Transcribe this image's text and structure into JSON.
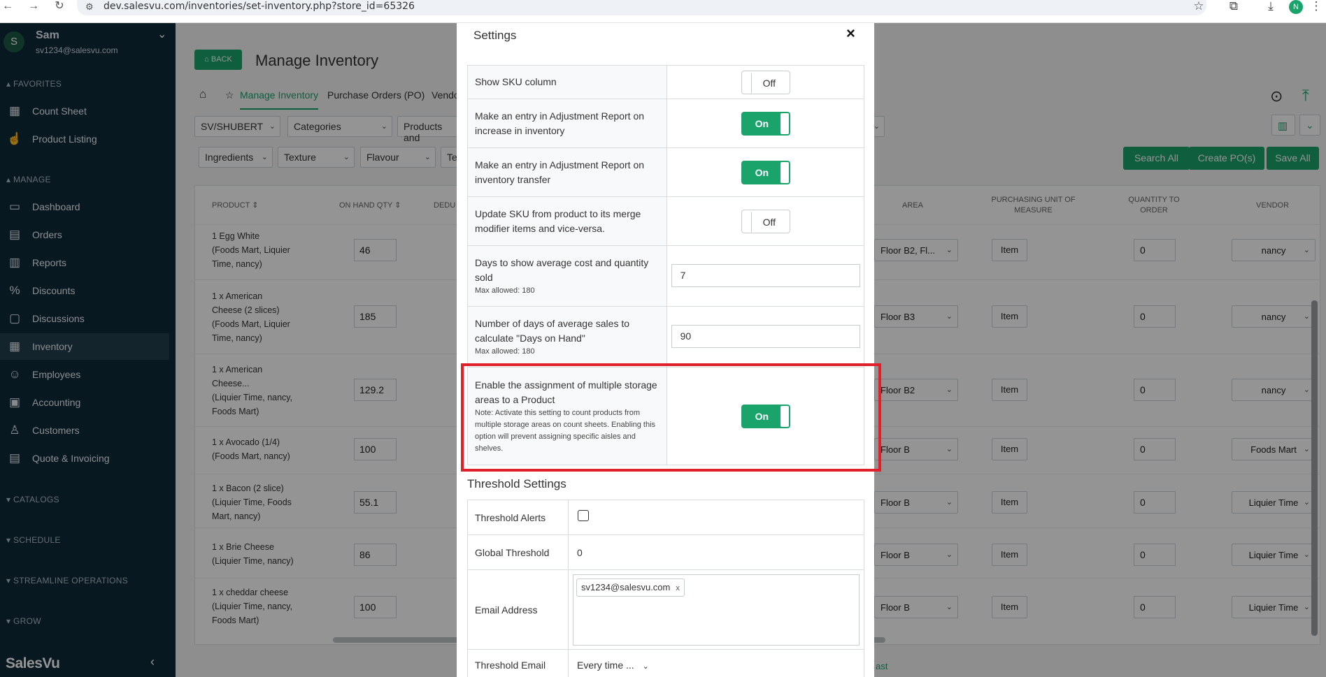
{
  "browser": {
    "url": "dev.salesvu.com/inventories/set-inventory.php?store_id=65326",
    "profile_initial": "N"
  },
  "sidebar": {
    "user_initial": "S",
    "user_name": "Sam",
    "user_email": "sv1234@salesvu.com",
    "favorites_label": "FAVORITES",
    "manage_label": "MANAGE",
    "favorites": [
      {
        "label": "Count Sheet",
        "icon": "grid-icon"
      },
      {
        "label": "Product Listing",
        "icon": "hand-icon"
      }
    ],
    "manage": [
      {
        "label": "Dashboard",
        "icon": "monitor-icon"
      },
      {
        "label": "Orders",
        "icon": "receipt-icon"
      },
      {
        "label": "Reports",
        "icon": "report-icon"
      },
      {
        "label": "Discounts",
        "icon": "percent-icon"
      },
      {
        "label": "Discussions",
        "icon": "chat-icon"
      },
      {
        "label": "Inventory",
        "icon": "grid-icon",
        "active": true
      },
      {
        "label": "Employees",
        "icon": "people-icon"
      },
      {
        "label": "Accounting",
        "icon": "calculator-icon"
      },
      {
        "label": "Customers",
        "icon": "person-icon"
      },
      {
        "label": "Quote & Invoicing",
        "icon": "invoice-icon"
      }
    ],
    "sections": [
      "CATALOGS",
      "SCHEDULE",
      "STREAMLINE OPERATIONS",
      "GROW"
    ],
    "brand": "SalesVu"
  },
  "page": {
    "back_label": "BACK",
    "title": "Manage Inventory",
    "tabs": [
      "Manage Inventory",
      "Purchase Orders (PO)",
      "Vendo"
    ],
    "filters_row1": [
      "SV/SHUBERT",
      "Categories",
      "Products and"
    ],
    "filters_row2": [
      "Ingredients",
      "Texture",
      "Flavour",
      "Te"
    ],
    "buttons": [
      "Search All",
      "Create PO(s)",
      "Save All"
    ],
    "columns": {
      "product": "PRODUCT",
      "on_hand": "ON HAND QTY",
      "deduct": "DEDU",
      "area": "AREA",
      "unit": "PURCHASING UNIT OF MEASURE",
      "order": "QUANTITY TO ORDER",
      "vendor": "VENDOR"
    },
    "rows": [
      {
        "name1": "1 Egg White",
        "name2": "(Foods Mart, Liquier",
        "name3": "Time, nancy)",
        "qty": "46",
        "area": "Floor B2, Fl...",
        "unit": "Item",
        "order": "0",
        "vendor": "nancy"
      },
      {
        "name1": "1 x American",
        "name2": "Cheese (2 slices)",
        "name3": "(Foods Mart, Liquier",
        "name4": "Time, nancy)",
        "qty": "185",
        "area": "Floor B3",
        "unit": "Item",
        "order": "0",
        "vendor": "nancy"
      },
      {
        "name1": "1 x American",
        "name2": "Cheese...",
        "name3": "(Liquier Time, nancy,",
        "name4": "Foods Mart)",
        "qty": "129.2",
        "area": "Floor B2",
        "unit": "Item",
        "order": "0",
        "vendor": "nancy"
      },
      {
        "name1": "1 x Avocado (1/4)",
        "name2": "(Foods Mart, nancy)",
        "qty": "100",
        "area": "Floor B",
        "unit": "Item",
        "order": "0",
        "vendor": "Foods Mart"
      },
      {
        "name1": "1 x Bacon (2 slice)",
        "name2": "(Liquier Time, Foods",
        "name3": "Mart, nancy)",
        "qty": "55.1",
        "area": "Floor B",
        "unit": "Item",
        "order": "0",
        "vendor": "Liquier Time"
      },
      {
        "name1": "1 x Brie Cheese",
        "name2": "(Liquier Time, nancy)",
        "qty": "86",
        "area": "Floor B",
        "unit": "Item",
        "order": "0",
        "vendor": "Liquier Time"
      },
      {
        "name1": "1 x cheddar cheese",
        "name2": "(Liquier Time, nancy,",
        "name3": "Foods Mart)",
        "qty": "100",
        "area": "Floor B",
        "unit": "Item",
        "order": "0",
        "vendor": "Liquier Time"
      }
    ],
    "footer_fragment": "ast"
  },
  "modal": {
    "title": "Settings",
    "close": "×",
    "settings": [
      {
        "label": "Show SKU column",
        "toggle": "Off"
      },
      {
        "label": "Make an entry in Adjustment Report on increase in inventory",
        "toggle": "On"
      },
      {
        "label": "Make an entry in Adjustment Report on inventory transfer",
        "toggle": "On"
      },
      {
        "label": "Update SKU from product to its merge modifier items and vice-versa.",
        "toggle": "Off"
      },
      {
        "label": "Days to show average cost and quantity sold",
        "note": "Max allowed: 180",
        "value": "7"
      },
      {
        "label": "Number of days of average sales to calculate \"Days on Hand\"",
        "note": "Max allowed: 180",
        "value": "90"
      },
      {
        "label": "Enable the assignment of multiple storage areas to a Product",
        "note": "Note: Activate this setting to count products from multiple storage areas on count sheets. Enabling this option will prevent assigning specific aisles and shelves.",
        "toggle": "On"
      }
    ],
    "threshold": {
      "title": "Threshold Settings",
      "alerts_label": "Threshold Alerts",
      "global_label": "Global Threshold",
      "global_value": "0",
      "email_label": "Email Address",
      "email_chip": "sv1234@salesvu.com",
      "email_chip_remove": "x",
      "threshold_email_label": "Threshold Email",
      "threshold_email_value": "Every time ..."
    }
  }
}
